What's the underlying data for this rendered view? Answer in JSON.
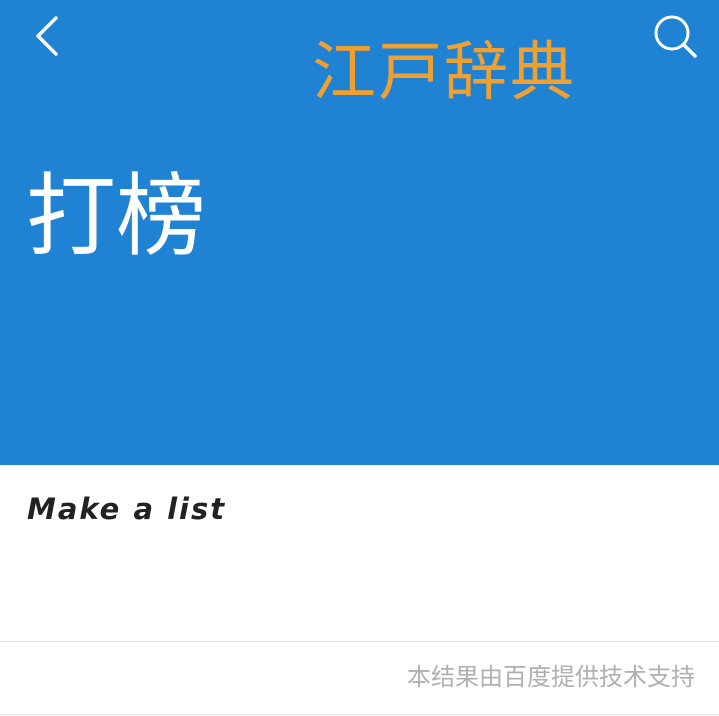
{
  "header": {
    "background_color": "#1f82d2",
    "back_icon": "chevron-left-icon",
    "search_icon": "search-icon",
    "app_title": "江戸辞典",
    "app_title_color": "#f0a030"
  },
  "entry": {
    "word": "打榜",
    "translation": "Make a list"
  },
  "footer": {
    "attribution": "本结果由百度提供技术支持"
  }
}
